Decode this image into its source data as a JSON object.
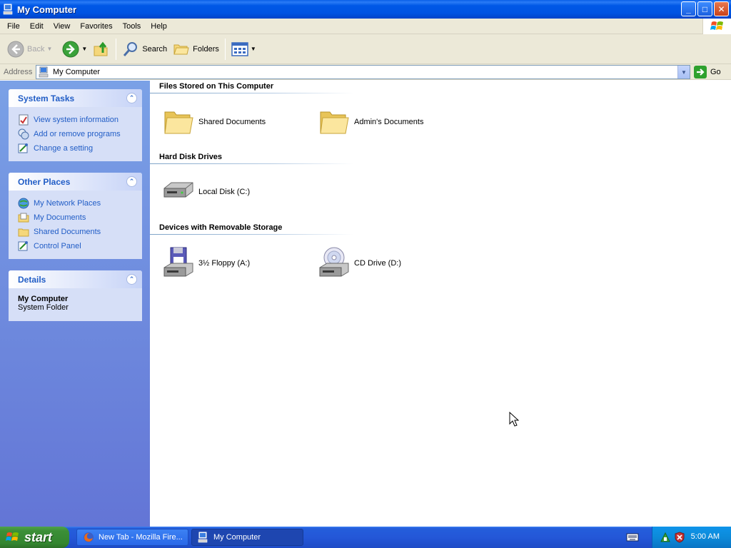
{
  "window": {
    "title": "My Computer",
    "controls": {
      "minimize": "_",
      "maximize": "□",
      "close": "✕"
    }
  },
  "menubar": {
    "items": [
      {
        "label": "File"
      },
      {
        "label": "Edit"
      },
      {
        "label": "View"
      },
      {
        "label": "Favorites"
      },
      {
        "label": "Tools"
      },
      {
        "label": "Help"
      }
    ]
  },
  "toolbar": {
    "back_label": "Back",
    "search_label": "Search",
    "folders_label": "Folders"
  },
  "address": {
    "label": "Address",
    "value": "My Computer",
    "go_label": "Go"
  },
  "sidebar": {
    "system_tasks": {
      "title": "System Tasks",
      "items": [
        {
          "label": "View system information",
          "icon": "system-info-icon"
        },
        {
          "label": "Add or remove programs",
          "icon": "programs-icon"
        },
        {
          "label": "Change a setting",
          "icon": "control-panel-icon"
        }
      ]
    },
    "other_places": {
      "title": "Other Places",
      "items": [
        {
          "label": "My Network Places",
          "icon": "network-icon"
        },
        {
          "label": "My Documents",
          "icon": "documents-icon"
        },
        {
          "label": "Shared Documents",
          "icon": "folder-icon"
        },
        {
          "label": "Control Panel",
          "icon": "control-panel-icon"
        }
      ]
    },
    "details": {
      "title": "Details",
      "name": "My Computer",
      "type": "System Folder"
    }
  },
  "content": {
    "groups": [
      {
        "header": "Files Stored on This Computer",
        "items": [
          {
            "label": "Shared Documents",
            "icon": "folder-icon"
          },
          {
            "label": "Admin's Documents",
            "icon": "folder-icon"
          }
        ]
      },
      {
        "header": "Hard Disk Drives",
        "items": [
          {
            "label": "Local Disk (C:)",
            "icon": "hard-disk-icon"
          }
        ]
      },
      {
        "header": "Devices with Removable Storage",
        "items": [
          {
            "label": "3½ Floppy (A:)",
            "icon": "floppy-drive-icon"
          },
          {
            "label": "CD Drive (D:)",
            "icon": "cd-drive-icon"
          }
        ]
      }
    ]
  },
  "taskbar": {
    "start_label": "start",
    "tasks": [
      {
        "label": "New Tab - Mozilla Fire...",
        "icon": "firefox-icon"
      },
      {
        "label": "My Computer",
        "icon": "computer-icon"
      }
    ],
    "clock": "5:00 AM"
  },
  "colors": {
    "titlebar": "#0054e3",
    "sidebar_link": "#215dc6",
    "taskbar": "#245edb",
    "start": "#3c8f37"
  }
}
